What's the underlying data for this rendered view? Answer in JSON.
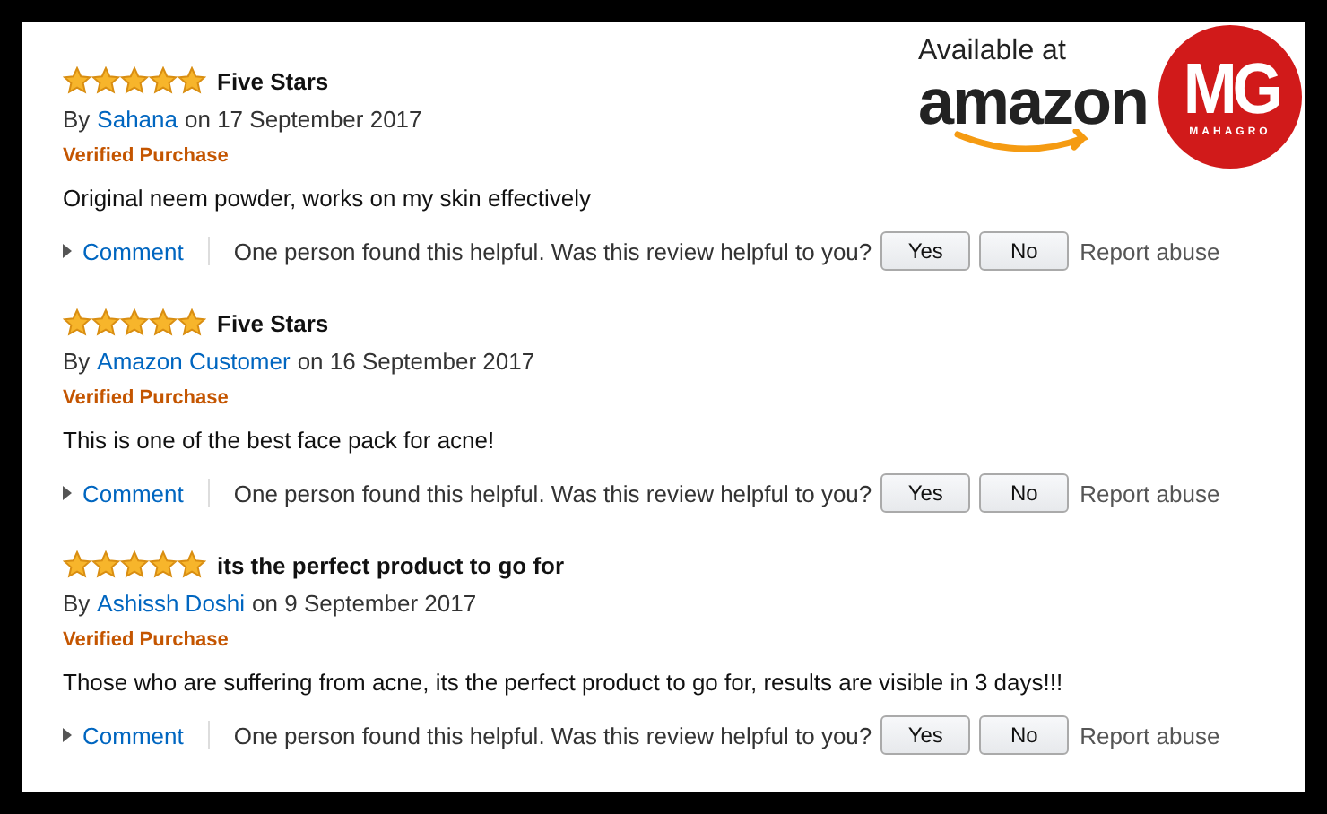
{
  "logo": {
    "tagline": "Available at",
    "brand": "amazon",
    "badge": "MG",
    "badge_sub": "MAHAGRO"
  },
  "reviews": [
    {
      "stars": 5,
      "title": "Five Stars",
      "by": "By",
      "author": "Sahana",
      "date": "on 17 September 2017",
      "badge": "Verified Purchase",
      "body": "Original neem powder, works on my skin effectively",
      "comment": "Comment",
      "helpful": "One person found this helpful. Was this review helpful to you?",
      "yes": "Yes",
      "no": "No",
      "report": "Report abuse"
    },
    {
      "stars": 5,
      "title": "Five Stars",
      "by": "By",
      "author": "Amazon Customer",
      "date": "on 16 September 2017",
      "badge": "Verified Purchase",
      "body": "This is one of the best face pack for acne!",
      "comment": "Comment",
      "helpful": "One person found this helpful. Was this review helpful to you?",
      "yes": "Yes",
      "no": "No",
      "report": "Report abuse"
    },
    {
      "stars": 5,
      "title": "its the perfect product to go for",
      "by": "By",
      "author": "Ashissh Doshi",
      "date": "on 9 September 2017",
      "badge": "Verified Purchase",
      "body": "Those who are suffering from acne, its the perfect product to go for, results are visible in 3 days!!!",
      "comment": "Comment",
      "helpful": "One person found this helpful. Was this review helpful to you?",
      "yes": "Yes",
      "no": "No",
      "report": "Report abuse"
    }
  ]
}
